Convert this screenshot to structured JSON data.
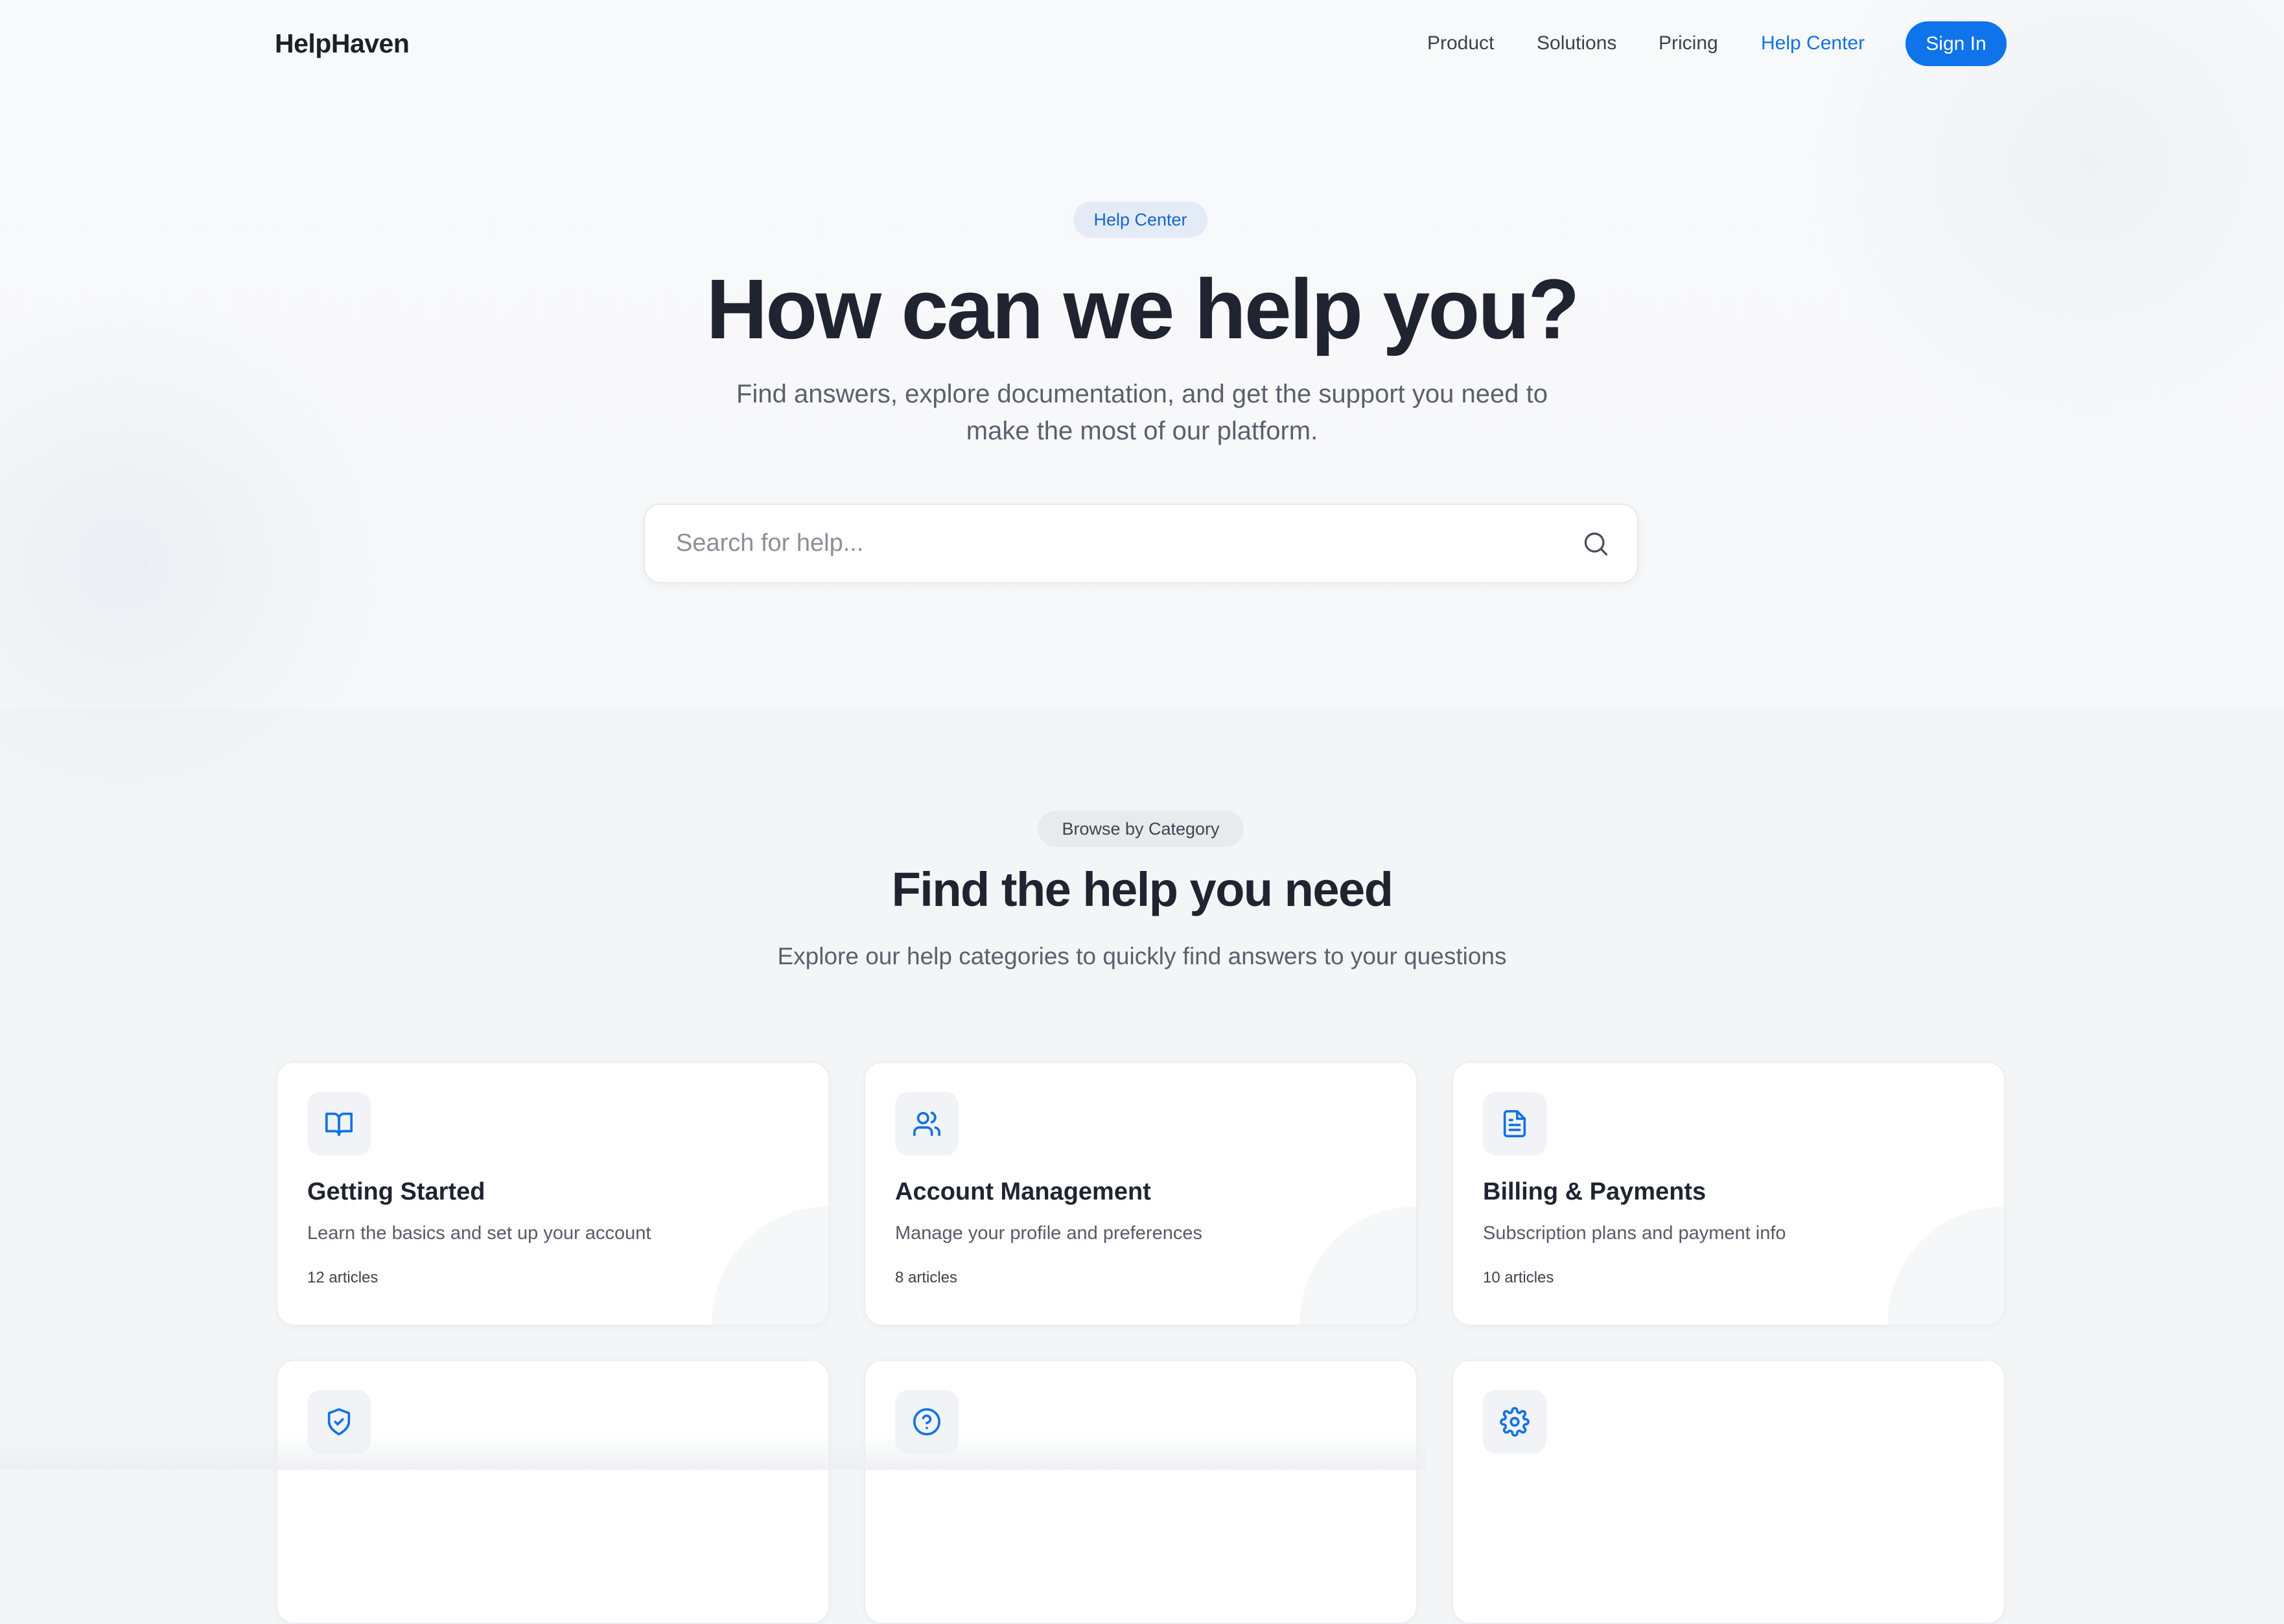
{
  "brand": {
    "name": "HelpHaven",
    "accent": "#0f73ea"
  },
  "nav": {
    "links": [
      "Product",
      "Solutions",
      "Pricing",
      "Help Center"
    ],
    "active": "Help Center",
    "signin_label": "Sign In"
  },
  "hero": {
    "badge": "Help Center",
    "title": "How can we help you?",
    "subtitle_line1": "Find answers, explore documentation, and get the support you need to",
    "subtitle_line2": "make the most of our platform.",
    "search": {
      "placeholder": "Search for help...",
      "value": "",
      "icon": "search-icon"
    }
  },
  "categories": {
    "badge": "Browse by Category",
    "title": "Find the help you need",
    "subtitle": "Explore our help categories to quickly find answers to your questions",
    "cards": [
      {
        "icon": "book-open-icon",
        "title": "Getting Started",
        "desc": "Learn the basics and set up your account",
        "count": "12 articles"
      },
      {
        "icon": "users-icon",
        "title": "Account Management",
        "desc": "Manage your profile and preferences",
        "count": "8 articles"
      },
      {
        "icon": "file-text-icon",
        "title": "Billing & Payments",
        "desc": "Subscription plans and payment info",
        "count": "10 articles"
      },
      {
        "icon": "shield-check-icon"
      },
      {
        "icon": "help-circle-icon"
      },
      {
        "icon": "settings-gear-icon"
      }
    ]
  }
}
